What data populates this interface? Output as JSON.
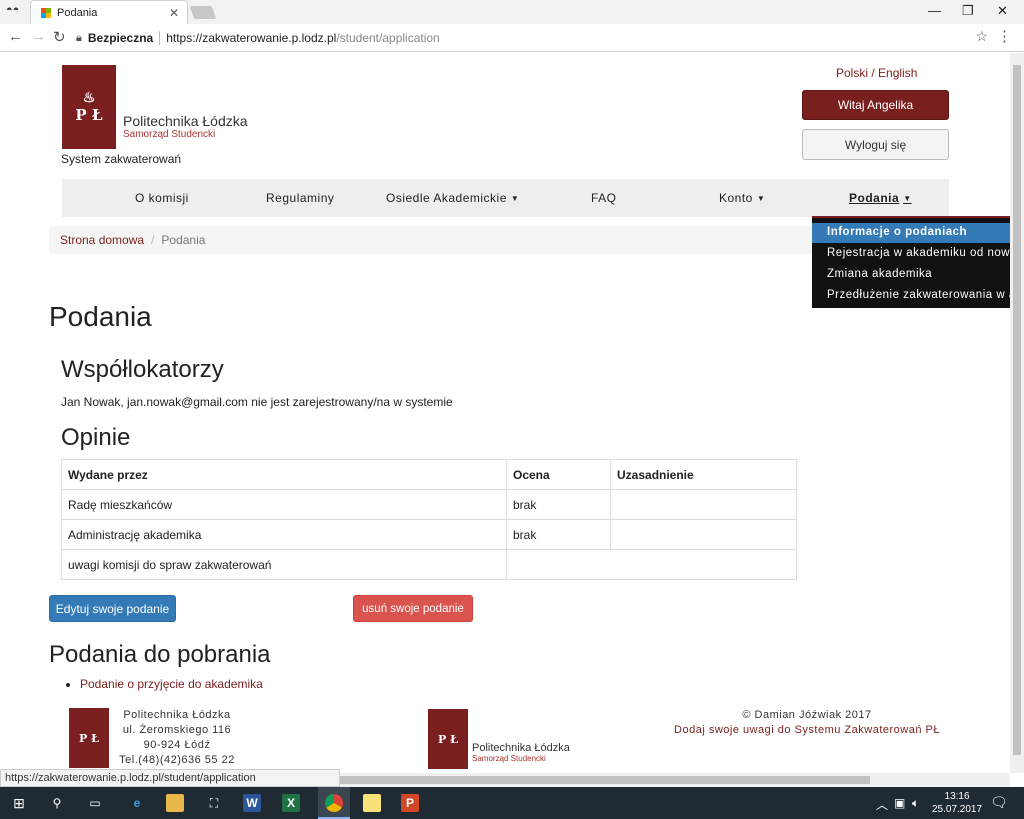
{
  "browser": {
    "tab_title": "Podania",
    "tab_close": "✕",
    "secure_label": "Bezpieczna",
    "url_host": "https://zakwaterowanie.p.lodz.pl",
    "url_path": "/student/application",
    "status_url": "https://zakwaterowanie.p.lodz.pl/student/application"
  },
  "header": {
    "logo_mark": "P Ł",
    "logo_name": "Politechnika Łódzka",
    "logo_sub": "Samorząd Studencki",
    "system_name": "System zakwaterowań",
    "languages": "Polski / English",
    "welcome_button": "Witaj Angelika",
    "logout_button": "Wyloguj się"
  },
  "nav": {
    "items": [
      {
        "label": "O komisji"
      },
      {
        "label": "Regulaminy"
      },
      {
        "label": "Osiedle Akademickie"
      },
      {
        "label": "FAQ"
      },
      {
        "label": "Konto"
      },
      {
        "label": "Podania"
      }
    ],
    "caret": "▼"
  },
  "dropdown": {
    "items": [
      {
        "label": "Informacje o podaniach"
      },
      {
        "label": "Rejestracja w akademiku od nowa"
      },
      {
        "label": "Zmiana akademika"
      },
      {
        "label": "Przedłużenie zakwaterowania w akademiku"
      }
    ]
  },
  "breadcrumb": {
    "home": "Strona domowa",
    "separator": "/",
    "current": "Podania"
  },
  "main": {
    "title": "Podania",
    "roommates_heading": "Współlokatorzy",
    "roommates_note": "Jan Nowak, jan.nowak@gmail.com nie jest zarejestrowany/na w systemie",
    "opinions_heading": "Opinie",
    "table": {
      "headers": [
        "Wydane przez",
        "Ocena",
        "Uzasadnienie"
      ],
      "rows": [
        [
          "Radę mieszkańców",
          "brak",
          ""
        ],
        [
          "Administrację akademika",
          "brak",
          ""
        ],
        [
          "uwagi komisji do spraw zakwaterowań",
          "",
          ""
        ]
      ]
    },
    "edit_button": "Edytuj swoje podanie",
    "delete_button": "usuń swoje podanie",
    "downloads_heading": "Podania do pobrania",
    "downloads": [
      {
        "label": "Podanie o przyjęcie do akademika"
      }
    ]
  },
  "footer": {
    "address_lines": [
      "Politechnika Łódzka",
      "ul. Żeromskiego 116",
      "90-924 Łódź",
      "Tel.(48)(42)636 55 22"
    ],
    "logo_name": "Politechnika Łódzka",
    "logo_sub": "Samorząd Studencki",
    "copyright": "© Damian Jóźwiak 2017",
    "feedback_link": "Dodaj swoje uwagi do Systemu Zakwaterowań PŁ"
  },
  "taskbar": {
    "time": "13:16",
    "date": "25.07.2017"
  },
  "colors": {
    "brand": "#7a1f1f",
    "primary": "#337ab7",
    "danger": "#d9534f"
  }
}
